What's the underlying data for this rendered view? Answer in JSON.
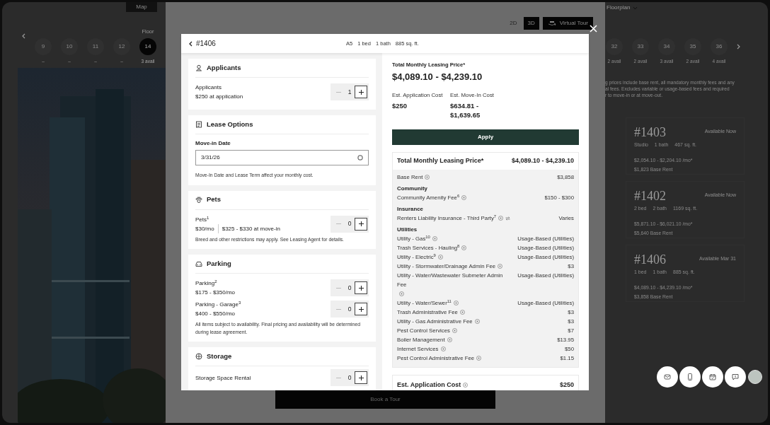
{
  "background": {
    "map_button": "Map",
    "floorplan_menu": "Floorplan",
    "floor_label": "Floor",
    "floors_left": [
      {
        "label": "9",
        "availability": "–",
        "selected": false
      },
      {
        "label": "10",
        "availability": "–",
        "selected": false
      },
      {
        "label": "11",
        "availability": "–",
        "selected": false
      },
      {
        "label": "12",
        "availability": "–",
        "selected": false
      },
      {
        "label": "14",
        "availability": "3 avail",
        "selected": true
      }
    ],
    "floors_right": [
      {
        "label": "32",
        "availability": "2 avail",
        "selected": false
      },
      {
        "label": "33",
        "availability": "2 avail",
        "selected": false
      },
      {
        "label": "34",
        "availability": "3 avail",
        "selected": false
      },
      {
        "label": "35",
        "availability": "2 avail",
        "selected": false
      },
      {
        "label": "36",
        "availability": "4 avail",
        "selected": false
      }
    ],
    "view_toggle": [
      {
        "label": "2D",
        "selected": false
      },
      {
        "label": "3D",
        "selected": true
      }
    ],
    "virtual_tour": "Virtual Tour",
    "disclaimer_lines": [
      "g prices include base rent, all mandatory monthly fees and any",
      "al fees. Excludes variable or usage-based fees and required",
      "r to move-in or at move-out."
    ],
    "units": [
      {
        "number": "#1403",
        "status": "Available Now",
        "specs": [
          "Studio",
          "1 bath",
          "467 sq. ft."
        ],
        "price": "$2,054.10 - $2,204.10 /mo*",
        "base_rent": "$1,823 Base Rent"
      },
      {
        "number": "#1402",
        "status": "Available Now",
        "specs": [
          "2 bed",
          "2 bath",
          "1169 sq. ft."
        ],
        "price": "$5,871.10 - $6,021.10 /mo*",
        "base_rent": "$5,640 Base Rent"
      },
      {
        "number": "#1406",
        "status": "Available Mar 31",
        "specs": [
          "1 bed",
          "1 bath",
          "885 sq. ft."
        ],
        "price": "$4,089.10 - $4,239.10 /mo*",
        "base_rent": "$3,858 Base Rent"
      }
    ],
    "book_tour": "Book a Tour"
  },
  "modal": {
    "back_label": "#1406",
    "specs": [
      "A5",
      "1 bed",
      "1 bath",
      "885 sq. ft."
    ],
    "sections": [
      {
        "kind": "counter",
        "title": "Applicants",
        "items": [
          {
            "name": "Applicants",
            "details": [
              "$250 at application"
            ],
            "count": "1",
            "minus_disabled": true
          }
        ]
      },
      {
        "kind": "date",
        "title": "Lease Options",
        "field_label": "Move-in Date",
        "value": "3/31/26",
        "note": "Move-In Date and Lease Term affect your monthly cost."
      },
      {
        "kind": "counter",
        "title": "Pets",
        "items": [
          {
            "name": "Pets$^{1}$",
            "details": [
              "$30/mo",
              "$325 - $330 at move-in"
            ],
            "count": "0",
            "minus_disabled": true
          }
        ],
        "note": "Breed and other restrictions may apply. See Leasing Agent for details."
      },
      {
        "kind": "counter",
        "title": "Parking",
        "items": [
          {
            "name": "Parking$^{2}$",
            "details": [
              "$175 - $350/mo"
            ],
            "count": "0",
            "minus_disabled": true
          },
          {
            "name": "Parking - Garage$^{3}$",
            "details": [
              "$400 - $550/mo"
            ],
            "count": "0",
            "minus_disabled": true
          }
        ],
        "note": "All items subject to availability. Final pricing and availability will be determined during lease agreement."
      },
      {
        "kind": "counter",
        "title": "Storage",
        "items": [
          {
            "name": "Storage Space Rental",
            "count": "0",
            "minus_disabled": true
          }
        ]
      }
    ],
    "summary": {
      "title": "Total Monthly Leasing Price*",
      "price": "$4,089.10 - $4,239.10",
      "costs": [
        {
          "label": "Est. Application Cost",
          "value": "$250"
        },
        {
          "label": "Est. Move-In Cost",
          "value": "$634.81 - $1,639.65"
        }
      ]
    },
    "apply_button": "Apply",
    "breakdown": {
      "title": "Total Monthly Leasing Price*",
      "value": "$4,089.10 - $4,239.10",
      "groups": [
        {
          "rows": [
            {
              "label": "Base Rent",
              "value": "$3,858"
            }
          ]
        },
        {
          "heading": "Community",
          "rows": [
            {
              "label": "Community Amenity Fee$^{6}$",
              "value": "$150 - $300"
            }
          ]
        },
        {
          "heading": "Insurance",
          "rows": [
            {
              "label": "Renters Liability Insurance - Third Party$^{7}$",
              "value": "Varies",
              "switchable": true
            }
          ]
        },
        {
          "heading": "Utilities",
          "rows": [
            {
              "label": "Utility - Gas$^{10}$",
              "value": "Usage-Based (Utilities)"
            },
            {
              "label": "Trash Services - Hauling$^{8}$",
              "value": "Usage-Based (Utilities)"
            },
            {
              "label": "Utility - Electric$^{9}$",
              "value": "Usage-Based (Utilities)"
            },
            {
              "label": "Utility - Stormwater/Drainage Admin Fee",
              "value": "$3"
            },
            {
              "label": "Utility - Water/Wastewater Submeter Admin Fee",
              "value": "Usage-Based (Utilities)"
            },
            {
              "label": "Utility - Water/Sewer$^{11}$",
              "value": "Usage-Based (Utilities)"
            },
            {
              "label": "Trash Administrative Fee",
              "value": "$3"
            },
            {
              "label": "Utility - Gas Administrative Fee",
              "value": "$3"
            },
            {
              "label": "Pest Control Services",
              "value": "$7"
            },
            {
              "label": "Boiler Management",
              "value": "$13.95"
            },
            {
              "label": "Internet Services",
              "value": "$50"
            },
            {
              "label": "Pest Control Administrative Fee",
              "value": "$1.15"
            }
          ]
        }
      ]
    },
    "application_cost": {
      "label": "Est. Application Cost",
      "value": "$250"
    }
  }
}
